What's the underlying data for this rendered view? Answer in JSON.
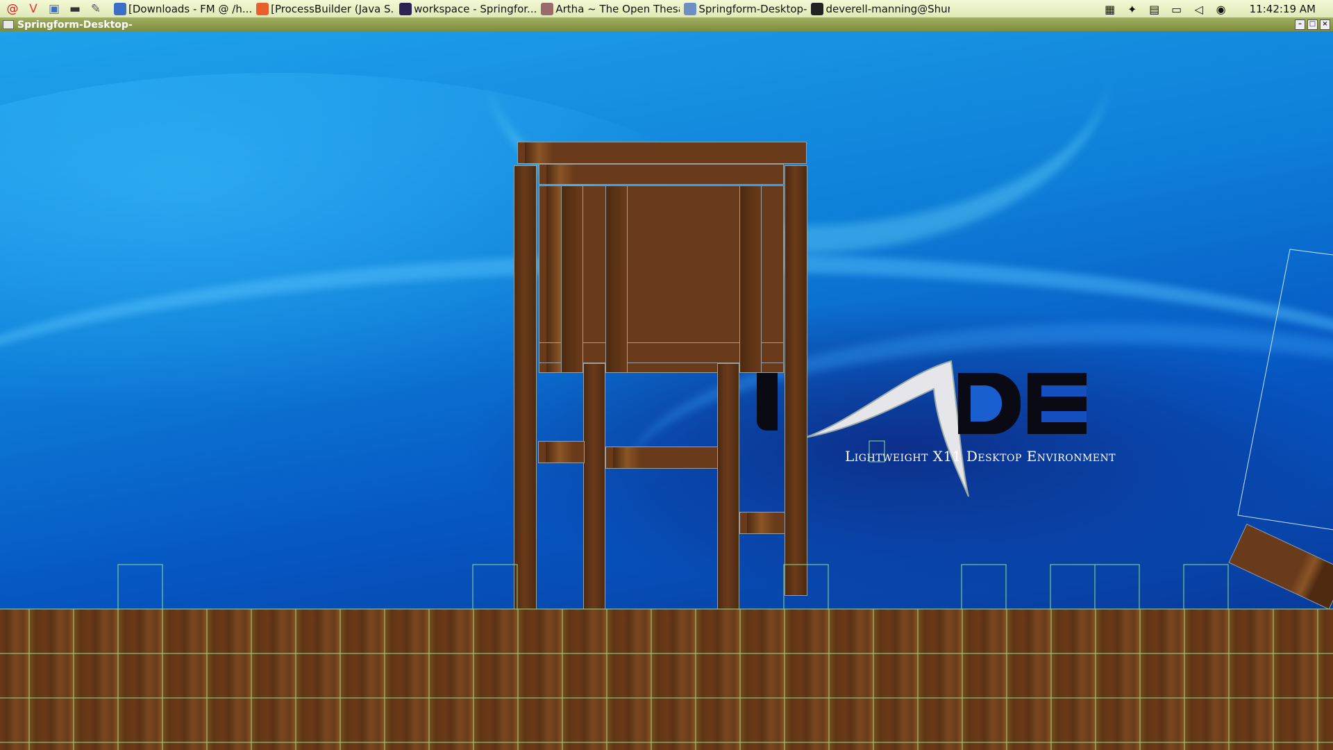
{
  "taskbar": {
    "launchers": [
      {
        "icon": "debian-swirl-icon",
        "glyph": "@"
      },
      {
        "icon": "vivaldi-browser-icon",
        "glyph": "V"
      },
      {
        "icon": "file-manager-icon",
        "glyph": "▣"
      },
      {
        "icon": "terminal-icon",
        "glyph": "▬"
      },
      {
        "icon": "editor-icon",
        "glyph": "✎"
      }
    ],
    "tasks": [
      {
        "label": "[Downloads - FM @ /h...",
        "icon": "folder-icon",
        "color": "#3b6fc7"
      },
      {
        "label": "[ProcessBuilder (Java S...",
        "icon": "firefox-icon",
        "color": "#e8602c"
      },
      {
        "label": "workspace - Springfor...",
        "icon": "eclipse-icon",
        "color": "#2c2255"
      },
      {
        "label": "Artha ~ The Open Thesa...",
        "icon": "book-icon",
        "color": "#9a6b6b"
      },
      {
        "label": "Springform-Desktop-",
        "icon": "window-icon",
        "color": "#6d8fc4"
      },
      {
        "label": "deverell-manning@Shur...",
        "icon": "terminal-icon",
        "color": "#222222"
      }
    ],
    "tray": [
      {
        "icon": "workspace-switcher-icon",
        "glyph": "▦"
      },
      {
        "icon": "color-picker-icon",
        "glyph": "✦"
      },
      {
        "icon": "dictionary-icon",
        "glyph": "▤"
      },
      {
        "icon": "network-icon",
        "glyph": "▭"
      },
      {
        "icon": "volume-muted-icon",
        "glyph": "◁"
      },
      {
        "icon": "microphone-icon",
        "glyph": "◉"
      }
    ],
    "clock": "11:42:19 AM"
  },
  "window": {
    "title": "Springform-Desktop-",
    "buttons": {
      "minimize": "–",
      "maximize": "□",
      "close": "×"
    }
  },
  "wallpaper": {
    "logo_text": "LXDE",
    "tagline": "Lightweight X11 Desktop Environment"
  },
  "colors": {
    "wood": "#6a3b1a",
    "wood_dark": "#4e2a10",
    "wood_light": "#8a5526",
    "outline": "#8fe08f",
    "taskbar_bg": "#eef4cc",
    "title_bg": "#8c9b4b"
  }
}
